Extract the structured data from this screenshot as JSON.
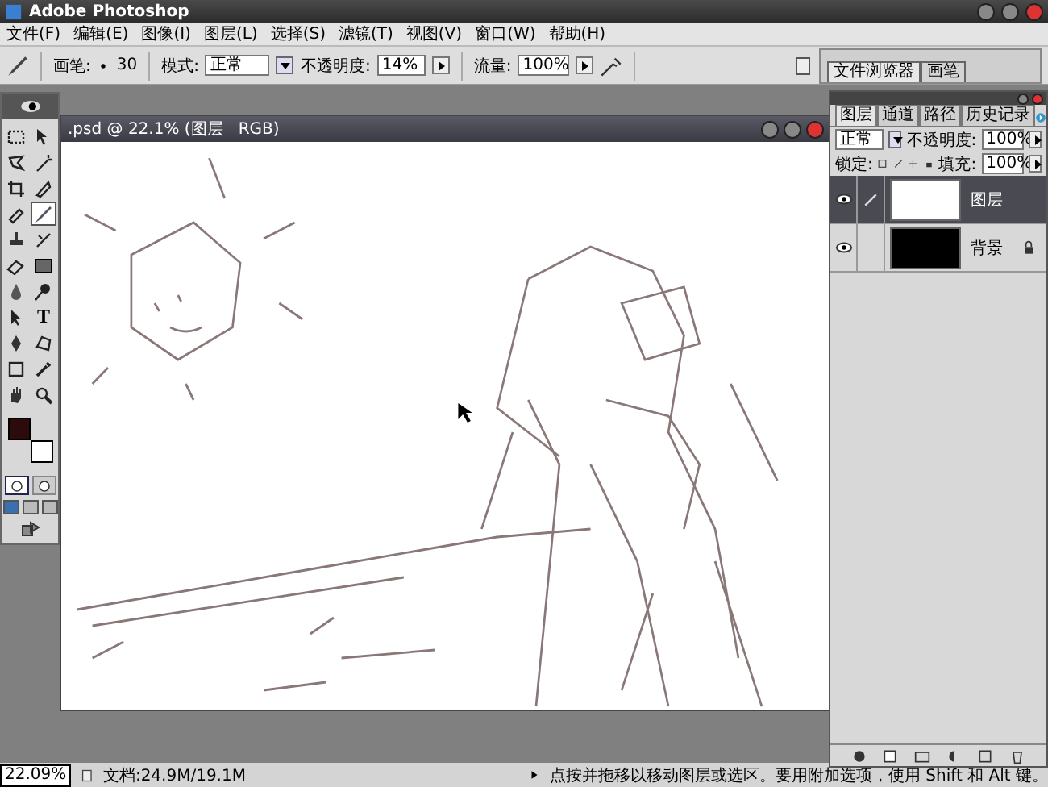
{
  "window": {
    "title": "Adobe Photoshop"
  },
  "menu": [
    "文件(F)",
    "编辑(E)",
    "图像(I)",
    "图层(L)",
    "选择(S)",
    "滤镜(T)",
    "视图(V)",
    "窗口(W)",
    "帮助(H)"
  ],
  "options_bar": {
    "brush_label": "画笔:",
    "brush_size": "30",
    "mode_label": "模式:",
    "mode": "正常",
    "opacity_label": "不透明度:",
    "opacity": "14%",
    "flow_label": "流量:",
    "flow": "100%"
  },
  "palette_well": [
    {
      "label": "文件浏览器",
      "selected": true
    },
    {
      "label": "画笔",
      "selected": false
    }
  ],
  "toolbox": {
    "tools": [
      {
        "kind": "marquee",
        "selected": false
      },
      {
        "kind": "move",
        "selected": false
      },
      {
        "kind": "lasso",
        "selected": false
      },
      {
        "kind": "wand",
        "selected": false
      },
      {
        "kind": "crop",
        "selected": false
      },
      {
        "kind": "slice",
        "selected": false
      },
      {
        "kind": "healing",
        "selected": false
      },
      {
        "kind": "brush",
        "selected": true
      },
      {
        "kind": "stamp",
        "selected": false
      },
      {
        "kind": "history",
        "selected": false
      },
      {
        "kind": "eraser",
        "selected": false
      },
      {
        "kind": "gradient",
        "selected": false
      },
      {
        "kind": "blur",
        "selected": false
      },
      {
        "kind": "dodge",
        "selected": false
      },
      {
        "kind": "select",
        "selected": false
      },
      {
        "kind": "type",
        "label": "T",
        "selected": false
      },
      {
        "kind": "pen",
        "selected": false
      },
      {
        "kind": "shape",
        "selected": false
      },
      {
        "kind": "notes",
        "selected": false
      },
      {
        "kind": "eyedropper",
        "selected": false
      },
      {
        "kind": "hand",
        "selected": false
      },
      {
        "kind": "zoom",
        "selected": false
      }
    ],
    "swatches": [
      {
        "kind": "foreground",
        "color": "#2b0b0b"
      },
      {
        "kind": "background",
        "color": "#ffffff"
      }
    ],
    "mask_modes": [
      {
        "kind": "standard",
        "selected": true
      },
      {
        "kind": "quickmask",
        "selected": false
      }
    ],
    "screen_modes": [
      {
        "selected": true
      },
      {
        "selected": false
      },
      {
        "selected": false
      }
    ]
  },
  "document": {
    "title": ".psd @ 22.1% (图层   RGB)"
  },
  "layers_panel": {
    "tabs": [
      {
        "label": "图层",
        "selected": true
      },
      {
        "label": "通道",
        "selected": false
      },
      {
        "label": "路径",
        "selected": false
      },
      {
        "label": "历史记录",
        "selected": false
      }
    ],
    "blend_mode": "正常",
    "opacity_label": "不透明度:",
    "opacity": "100%",
    "lock_label": "锁定:",
    "fill_label": "填充:",
    "fill": "100%",
    "layers": [
      {
        "name": "图层",
        "kind": "sketch",
        "visible": true,
        "selected": true,
        "locked": false
      },
      {
        "name": "背景",
        "kind": "solid",
        "visible": true,
        "selected": false,
        "locked": true
      }
    ]
  },
  "status_bar": {
    "zoom": "22.09%",
    "doc_size": "文档:24.9M/19.1M",
    "message": "点按并拖移以移动图层或选区。要用附加选项，使用 Shift 和 Alt 键。"
  }
}
